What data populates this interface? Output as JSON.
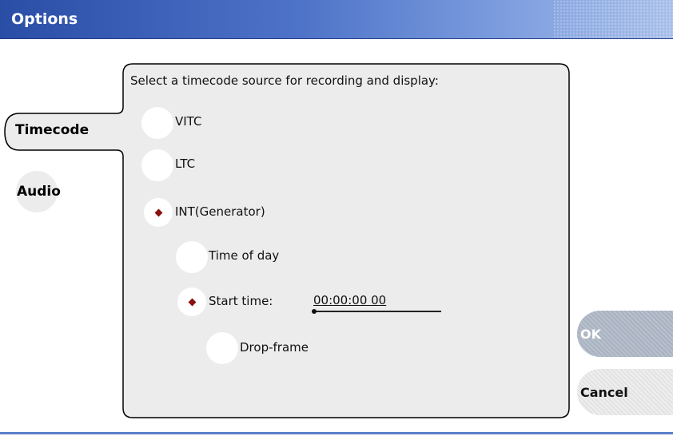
{
  "window": {
    "title": "Options"
  },
  "tabs": [
    {
      "label": "Timecode",
      "active": true
    },
    {
      "label": "Audio",
      "active": false
    }
  ],
  "timecode": {
    "instructions": "Select a timecode source for recording and display:",
    "source_options": [
      {
        "label": "VITC",
        "selected": false
      },
      {
        "label": "LTC",
        "selected": false
      },
      {
        "label": "INT(Generator)",
        "selected": true
      }
    ],
    "generator_options": [
      {
        "label": "Time of day",
        "selected": false
      },
      {
        "label": "Start time:",
        "selected": true
      }
    ],
    "start_time_value": "00:00:00 00",
    "drop_frame": {
      "label": "Drop-frame",
      "checked": false
    }
  },
  "buttons": {
    "ok_label": "OK",
    "cancel_label": "Cancel"
  },
  "colors": {
    "title_bar": "#2a4da6",
    "panel_bg": "#ececec",
    "selected_dot": "#8b1010",
    "ok_button": "#a8b2c1"
  }
}
